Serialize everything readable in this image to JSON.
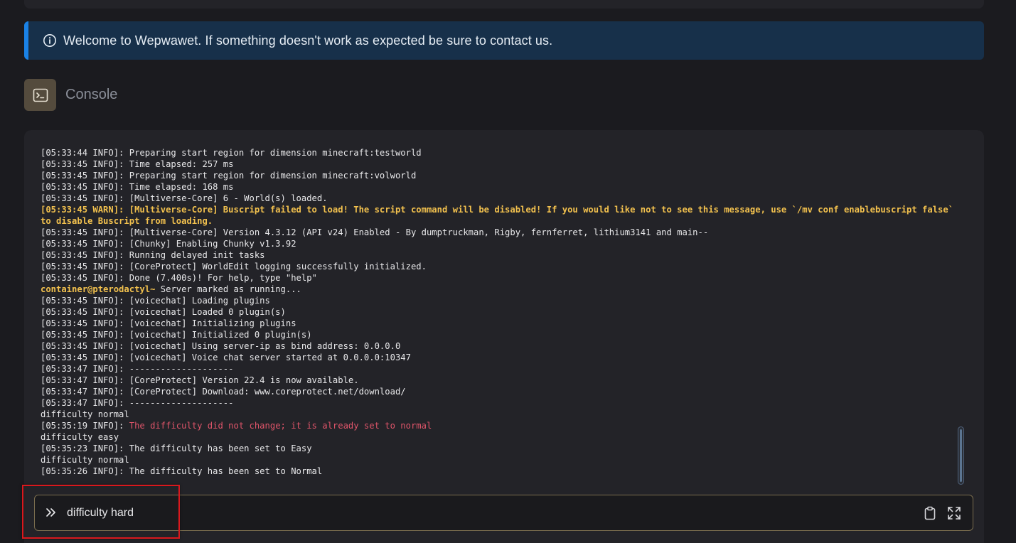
{
  "alert": {
    "message": "Welcome to Wepwawet. If something doesn't work as expected be sure to contact us.",
    "icon": "info-circle-icon"
  },
  "console": {
    "title": "Console",
    "icon": "terminal-icon"
  },
  "log_lines": [
    {
      "type": "info",
      "text": "[05:33:44 INFO]: Preparing start region for dimension minecraft:testworld"
    },
    {
      "type": "info",
      "text": "[05:33:45 INFO]: Time elapsed: 257 ms"
    },
    {
      "type": "info",
      "text": "[05:33:45 INFO]: Preparing start region for dimension minecraft:volworld"
    },
    {
      "type": "info",
      "text": "[05:33:45 INFO]: Time elapsed: 168 ms"
    },
    {
      "type": "info",
      "text": "[05:33:45 INFO]: [Multiverse-Core] 6 - World(s) loaded."
    },
    {
      "type": "warn",
      "text": "[05:33:45 WARN]: [Multiverse-Core] Buscript failed to load! The script command will be disabled! If you would like not to see this message, use `/mv conf enablebuscript false` to disable Buscript from loading."
    },
    {
      "type": "info",
      "text": "[05:33:45 INFO]: [Multiverse-Core] Version 4.3.12 (API v24) Enabled - By dumptruckman, Rigby, fernferret, lithium3141 and main--"
    },
    {
      "type": "info",
      "text": "[05:33:45 INFO]: [Chunky] Enabling Chunky v1.3.92"
    },
    {
      "type": "info",
      "text": "[05:33:45 INFO]: Running delayed init tasks"
    },
    {
      "type": "info",
      "text": "[05:33:45 INFO]: [CoreProtect] WorldEdit logging successfully initialized."
    },
    {
      "type": "info",
      "text": "[05:33:45 INFO]: Done (7.400s)! For help, type \"help\""
    },
    {
      "type": "prompt",
      "user": "container@pterodactyl~",
      "text": " Server marked as running..."
    },
    {
      "type": "info",
      "text": "[05:33:45 INFO]: [voicechat] Loading plugins"
    },
    {
      "type": "info",
      "text": "[05:33:45 INFO]: [voicechat] Loaded 0 plugin(s)"
    },
    {
      "type": "info",
      "text": "[05:33:45 INFO]: [voicechat] Initializing plugins"
    },
    {
      "type": "info",
      "text": "[05:33:45 INFO]: [voicechat] Initialized 0 plugin(s)"
    },
    {
      "type": "info",
      "text": "[05:33:45 INFO]: [voicechat] Using server-ip as bind address: 0.0.0.0"
    },
    {
      "type": "info",
      "text": "[05:33:45 INFO]: [voicechat] Voice chat server started at 0.0.0.0:10347"
    },
    {
      "type": "info",
      "text": "[05:33:47 INFO]: --------------------"
    },
    {
      "type": "info",
      "text": "[05:33:47 INFO]: [CoreProtect] Version 22.4 is now available."
    },
    {
      "type": "info",
      "text": "[05:33:47 INFO]: [CoreProtect] Download: www.coreprotect.net/download/"
    },
    {
      "type": "info",
      "text": "[05:33:47 INFO]: --------------------"
    },
    {
      "type": "info",
      "text": "difficulty normal"
    },
    {
      "type": "error",
      "prefix": "[05:35:19 INFO]: ",
      "text": "The difficulty did not change; it is already set to normal"
    },
    {
      "type": "info",
      "text": "difficulty easy"
    },
    {
      "type": "info",
      "text": "[05:35:23 INFO]: The difficulty has been set to Easy"
    },
    {
      "type": "info",
      "text": "difficulty normal"
    },
    {
      "type": "info",
      "text": "[05:35:26 INFO]: The difficulty has been set to Normal"
    }
  ],
  "command_input": {
    "value": "difficulty hard",
    "prompt_icon": "chevrons-right-icon"
  },
  "actions": {
    "copy_icon": "clipboard-icon",
    "fullscreen_icon": "expand-icon"
  },
  "colors": {
    "alert_bg": "#17304a",
    "alert_stripe": "#1a82e6",
    "warn": "#f2c14e",
    "error": "#e0556a",
    "highlight": "#d9181d"
  }
}
